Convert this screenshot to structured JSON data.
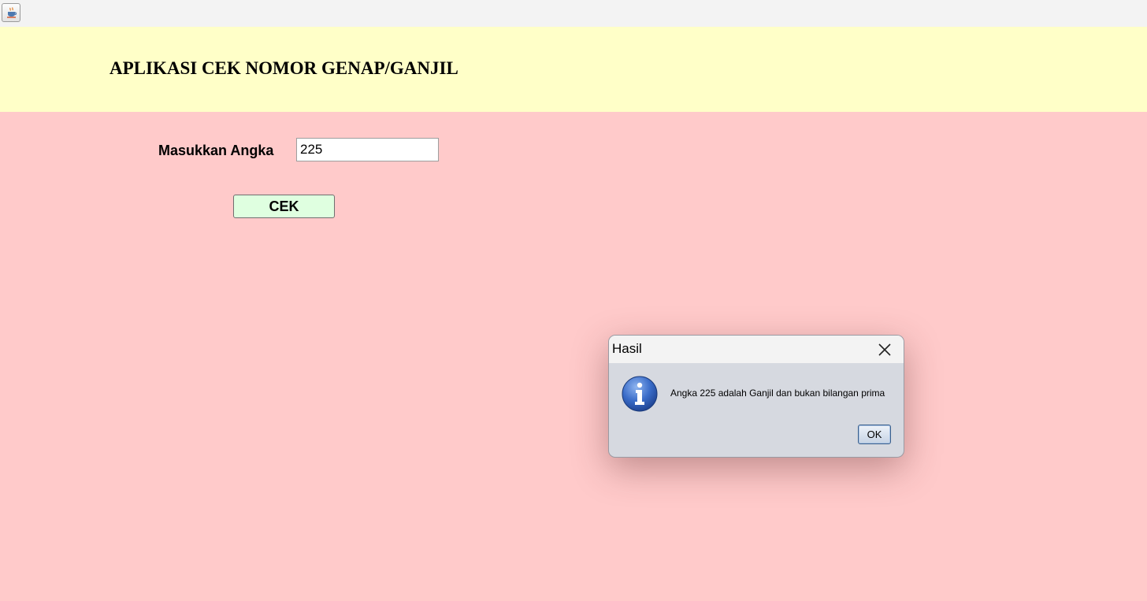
{
  "window": {
    "icon": "java-cup-icon"
  },
  "header": {
    "title": "APLIKASI CEK NOMOR GENAP/GANJIL",
    "background": "#ffffc8"
  },
  "form": {
    "input_label": "Masukkan Angka",
    "input_value": "225",
    "button_label": "CEK",
    "background": "#ffcaca",
    "button_color": "#dfffe0"
  },
  "dialog": {
    "title": "Hasil",
    "icon": "info-icon",
    "message": "Angka 225 adalah Ganjil dan bukan bilangan prima",
    "ok_label": "OK",
    "close_icon": "close-icon"
  }
}
